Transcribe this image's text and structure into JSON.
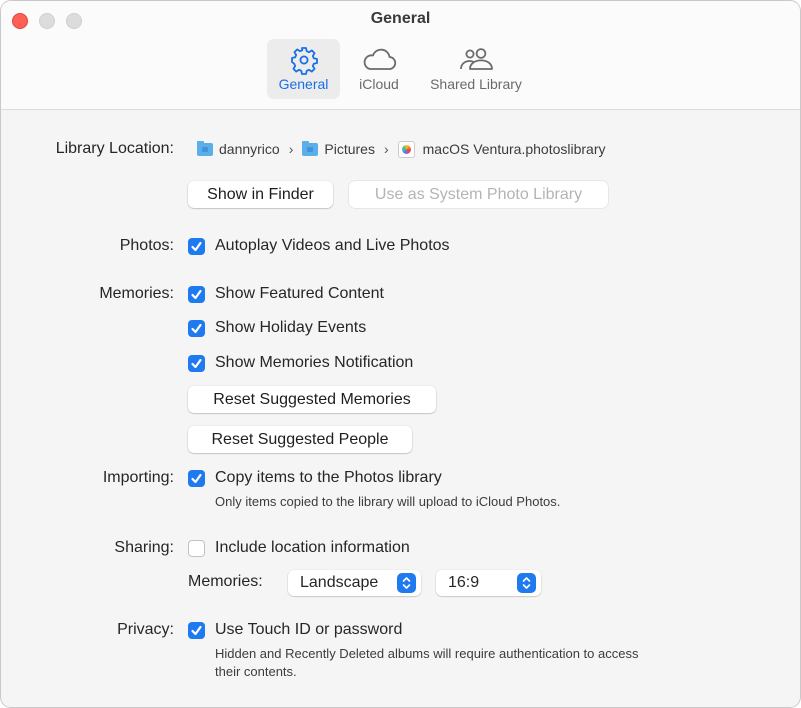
{
  "window": {
    "title": "General",
    "controls": {
      "close": "close-button",
      "minimize": "minimize-button",
      "zoom": "zoom-button"
    }
  },
  "tabs": [
    {
      "label": "General",
      "icon": "gear-icon",
      "active": true
    },
    {
      "label": "iCloud",
      "icon": "cloud-icon",
      "active": false
    },
    {
      "label": "Shared Library",
      "icon": "people-icon",
      "active": false
    }
  ],
  "library": {
    "label": "Library Location:",
    "path": [
      {
        "name": "dannyrico",
        "icon": "home-folder-icon"
      },
      {
        "name": "Pictures",
        "icon": "pictures-folder-icon"
      },
      {
        "name": "macOS Ventura.photoslibrary",
        "icon": "photos-library-icon"
      }
    ],
    "show_in_finder": "Show in Finder",
    "use_as_system": "Use as System Photo Library"
  },
  "photos": {
    "label": "Photos:",
    "autoplay": {
      "label": "Autoplay Videos and Live Photos",
      "checked": true
    }
  },
  "memories": {
    "label": "Memories:",
    "featured": {
      "label": "Show Featured Content",
      "checked": true
    },
    "holiday": {
      "label": "Show Holiday Events",
      "checked": true
    },
    "notification": {
      "label": "Show Memories Notification",
      "checked": true
    },
    "reset_memories": "Reset Suggested Memories",
    "reset_people": "Reset Suggested People"
  },
  "importing": {
    "label": "Importing:",
    "copy": {
      "label": "Copy items to the Photos library",
      "checked": true
    },
    "note": "Only items copied to the library will upload to iCloud Photos."
  },
  "sharing": {
    "label": "Sharing:",
    "location": {
      "label": "Include location information",
      "checked": false
    },
    "memories_label": "Memories:",
    "orientation": "Landscape",
    "aspect": "16:9"
  },
  "privacy": {
    "label": "Privacy:",
    "touch_id": {
      "label": "Use Touch ID or password",
      "checked": true
    },
    "note_line1": "Hidden and Recently Deleted albums will require authentication to access",
    "note_line2": "their contents."
  },
  "colors": {
    "accent": "#1f7af0",
    "close": "#fe5f57"
  }
}
